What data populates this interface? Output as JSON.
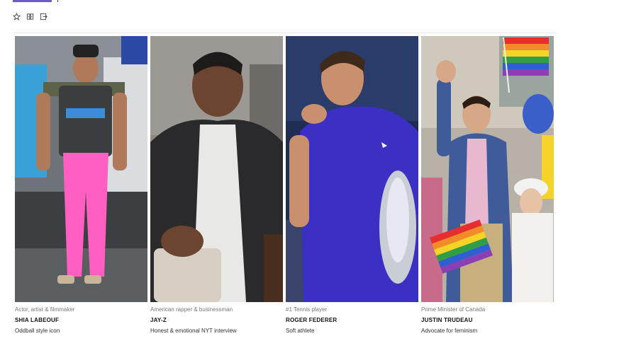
{
  "toolbar": {
    "icons": [
      "star-icon",
      "compare-icon",
      "share-icon"
    ]
  },
  "colors": {
    "accent": "#6a5acd",
    "pink": "#ff5fc0",
    "blue_shirt": "#3b2fc4",
    "pride": [
      "#e62e2e",
      "#f28c28",
      "#f5d327",
      "#2f9e44",
      "#2f5fd0",
      "#8a3fb5"
    ]
  },
  "cards": [
    {
      "tag": "Actor, artist & filmmaker",
      "name": "SHIA LABEOUF",
      "desc": "Oddball style icon"
    },
    {
      "tag": "American rapper & businessman",
      "name": "JAY-Z",
      "desc": "Honest & emotional NYT interview"
    },
    {
      "tag": "#1 Tennis player",
      "name": "ROGER FEDERER",
      "desc": "Soft athlete"
    },
    {
      "tag": "Prime Minister of Canada",
      "name": "JUSTIN TRUDEAU",
      "desc": "Advocate for feminism"
    }
  ]
}
